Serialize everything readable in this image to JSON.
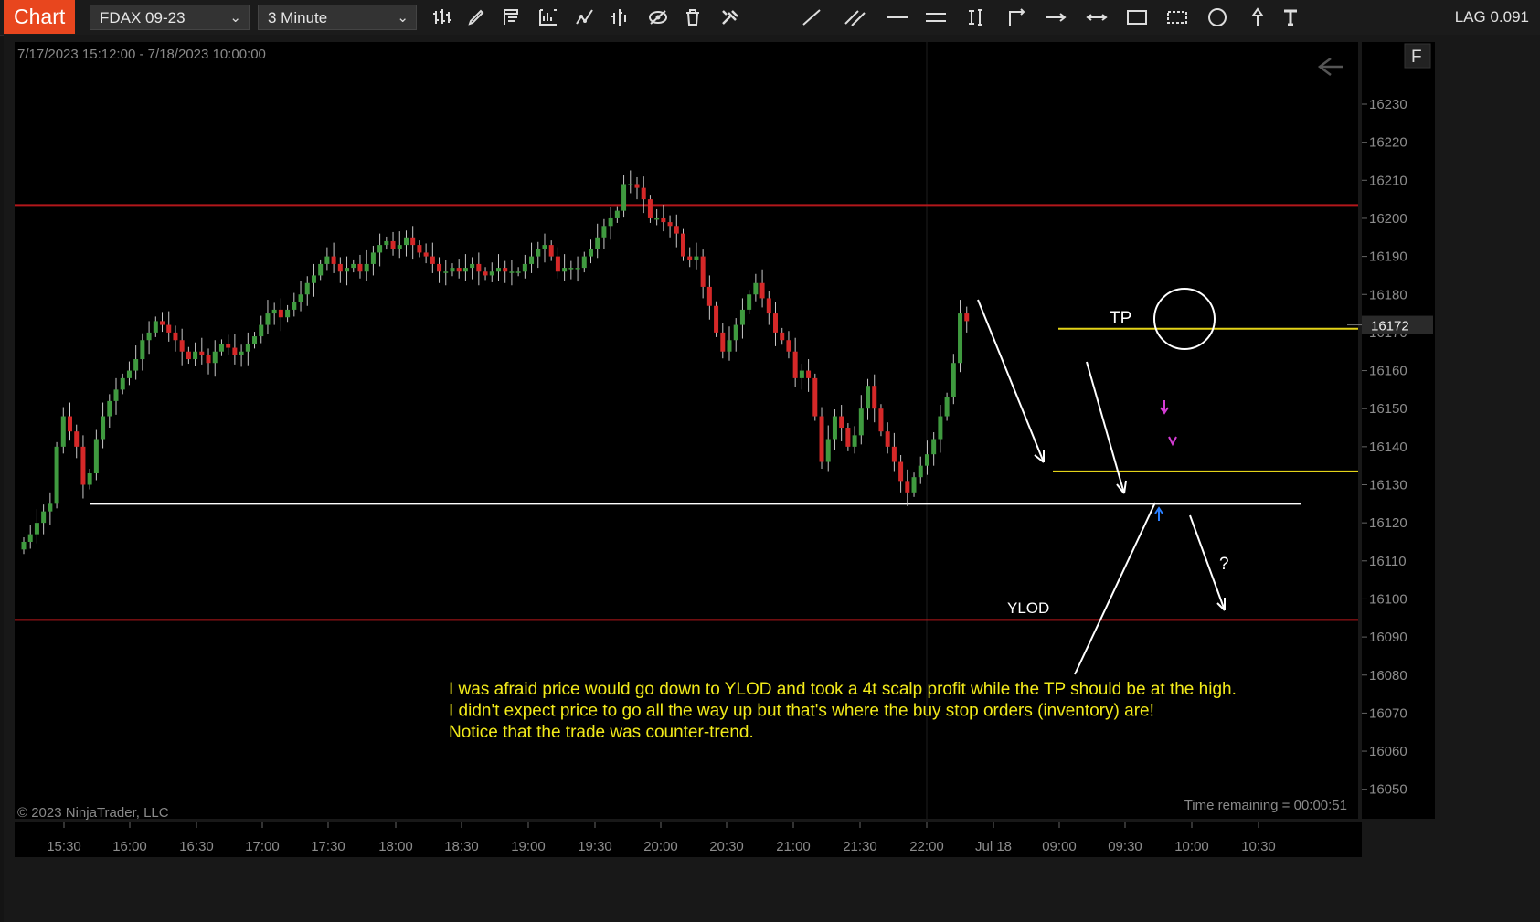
{
  "toolbar": {
    "tab_label": "Chart",
    "instrument": "FDAX 09-23",
    "interval": "3 Minute",
    "tools": [
      "bars-icon",
      "pencil-icon",
      "data-box-icon",
      "bar-chart-icon",
      "indicator-icon",
      "strategy-icon",
      "eye-icon",
      "trash-icon",
      "tools-icon",
      "line-icon",
      "channel-icon",
      "horizontal-line-icon",
      "double-line-icon",
      "measure-icon",
      "ray-icon",
      "arrow-line-icon",
      "extended-line-icon",
      "rectangle-icon",
      "region-icon",
      "ellipse-icon",
      "arrow-up-icon",
      "text-icon"
    ],
    "lag": "LAG 0.091"
  },
  "chart_data": {
    "type": "candlestick",
    "range_label": "7/17/2023 15:12:00 - 7/18/2023 10:00:00",
    "price_axis": {
      "ticks": [
        16050,
        16060,
        16070,
        16080,
        16090,
        16100,
        16110,
        16120,
        16130,
        16140,
        16150,
        16160,
        16170,
        16180,
        16190,
        16200,
        16210,
        16220,
        16230
      ],
      "current_price_label": "16172",
      "current_price": 16172,
      "range": [
        16045,
        16240
      ]
    },
    "time_axis": {
      "ticks": [
        "15:30",
        "16:00",
        "16:30",
        "17:00",
        "17:30",
        "18:00",
        "18:30",
        "19:00",
        "19:30",
        "20:00",
        "20:30",
        "21:00",
        "21:30",
        "22:00",
        "Jul 18",
        "09:00",
        "09:30",
        "10:00",
        "10:30"
      ]
    },
    "close_path": [
      16115,
      16117,
      16120,
      16123,
      16125,
      16140,
      16148,
      16144,
      16140,
      16130,
      16133,
      16142,
      16148,
      16152,
      16155,
      16158,
      16160,
      16163,
      16168,
      16170,
      16173,
      16172,
      16170,
      16168,
      16165,
      16163,
      16165,
      16164,
      16162,
      16165,
      16167,
      16166,
      16164,
      16165,
      16167,
      16169,
      16172,
      16175,
      16176,
      16174,
      16176,
      16178,
      16180,
      16183,
      16185,
      16188,
      16190,
      16188,
      16186,
      16187,
      16188,
      16186,
      16188,
      16191,
      16193,
      16194,
      16192,
      16193,
      16195,
      16193,
      16191,
      16190,
      16188,
      16186,
      16186,
      16187,
      16186,
      16187,
      16188,
      16186,
      16185,
      16186,
      16187,
      16186,
      16186,
      16186,
      16188,
      16190,
      16192,
      16193,
      16190,
      16186,
      16187,
      16187,
      16187,
      16190,
      16192,
      16195,
      16198,
      16200,
      16202,
      16209,
      16209,
      16208,
      16205,
      16200,
      16200,
      16199,
      16198,
      16196,
      16190,
      16189,
      16190,
      16182,
      16177,
      16170,
      16165,
      16168,
      16172,
      16176,
      16180,
      16183,
      16179,
      16175,
      16170,
      16168,
      16165,
      16158,
      16160,
      16158,
      16148,
      16136,
      16142,
      16148,
      16145,
      16140,
      16143,
      16150,
      16156,
      16150,
      16144,
      16140,
      16136,
      16131,
      16128,
      16132,
      16135,
      16138,
      16142,
      16148,
      16153,
      16162,
      16175,
      16173
    ],
    "horizontal_lines": [
      {
        "price": 16203.5,
        "color": "#b3171b"
      },
      {
        "price": 16094.5,
        "color": "#b3171b"
      },
      {
        "price": 16171,
        "color": "#e3d319"
      },
      {
        "price": 16133.5,
        "color": "#e3d319"
      },
      {
        "price": 16125,
        "color": "#ffffff"
      }
    ],
    "labels": {
      "tp": "TP",
      "ylod": "YLOD",
      "question": "?"
    },
    "note_lines": [
      "I was afraid price would go down to YLOD and took a 4t scalp profit while the TP should be at the high.",
      "I didn't expect price to go all the way up but that's where the buy stop orders (inventory) are!",
      "Notice that the trade was counter-trend."
    ],
    "copyright": "© 2023 NinjaTrader, LLC",
    "time_remaining": "Time remaining = 00:00:51",
    "f_button": "F",
    "colors": {
      "up": "#3f9a3f",
      "down": "#d52828",
      "note": "#f2ea1a",
      "background": "#000000"
    }
  }
}
